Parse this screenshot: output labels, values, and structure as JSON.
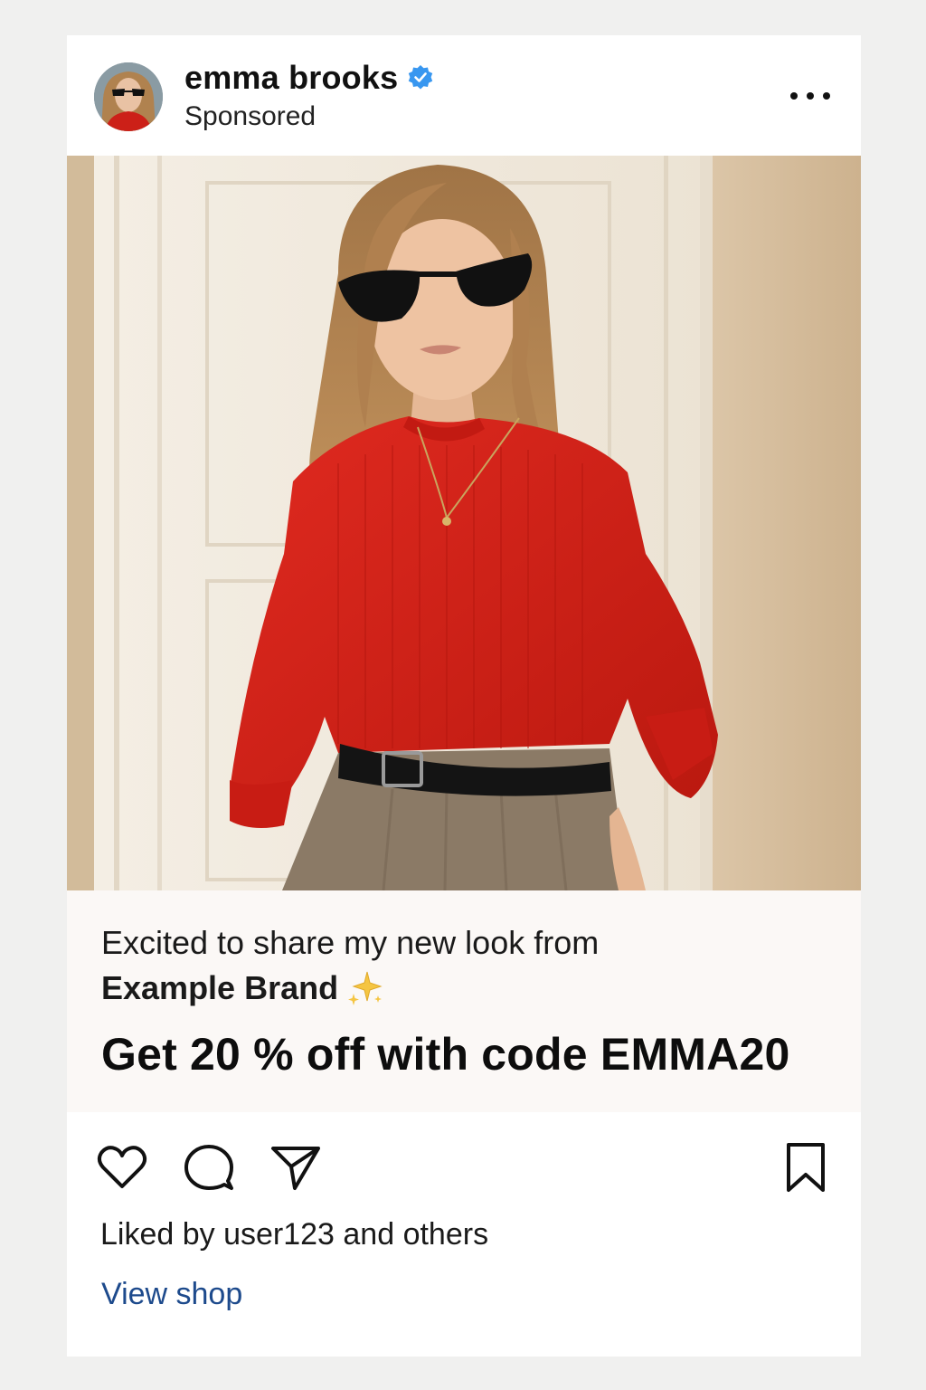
{
  "post": {
    "author": {
      "name": "emma brooks",
      "label": "Sponsored",
      "verified": true,
      "verified_color": "#3897f0"
    },
    "more_icon": "more-horizontal-icon",
    "caption": {
      "line1": "Excited to share my new look from",
      "brand": "Example Brand",
      "emoji": "sparkles-icon",
      "promo": "Get 20 % off with code EMMA20"
    },
    "actions": {
      "like_icon": "heart-icon",
      "comment_icon": "comment-bubble-icon",
      "share_icon": "send-icon",
      "save_icon": "bookmark-icon"
    },
    "likes_text": "Liked by user123 and others",
    "cta_link": "View shop",
    "colors": {
      "link": "#1d4a8c",
      "sweater": "#d0201c",
      "caption_bg": "#fbf8f6"
    }
  }
}
